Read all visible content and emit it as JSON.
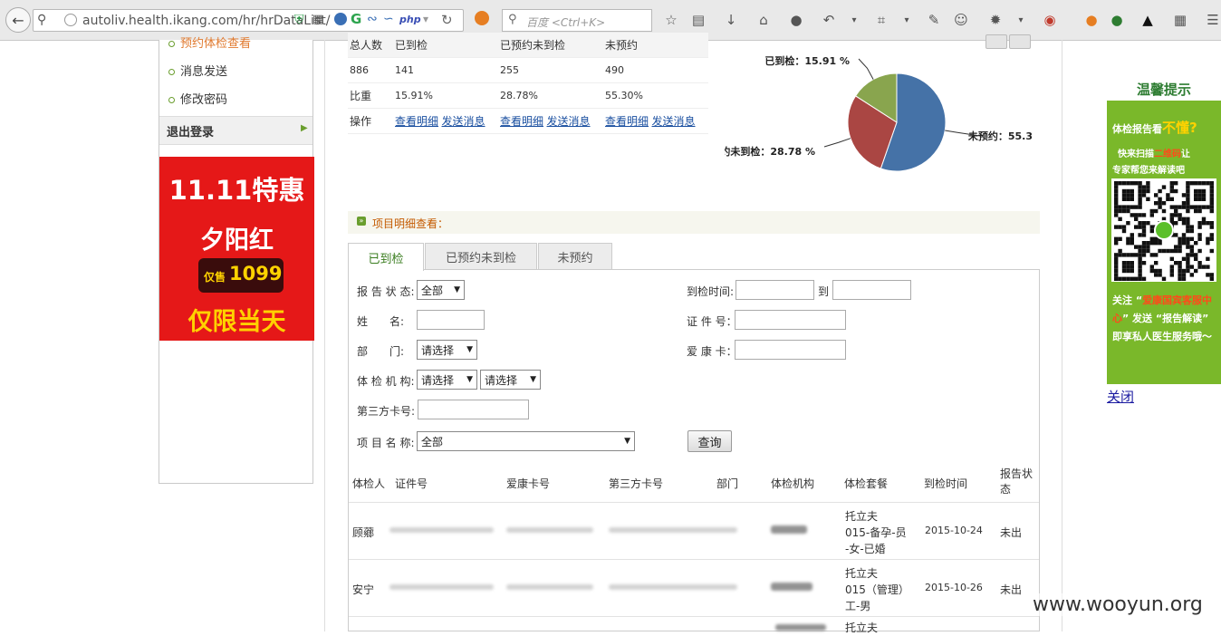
{
  "browser": {
    "url": "autoliv.health.ikang.com/hr/hrDataList/",
    "search_placeholder": "百度 <Ctrl+K>",
    "ext_php": "php"
  },
  "sidebar": {
    "items": [
      {
        "label": "预约体检查看"
      },
      {
        "label": "消息发送"
      },
      {
        "label": "修改密码"
      }
    ],
    "logout": "退出登录",
    "ad": {
      "line1": "11.11特惠",
      "line2": "夕阳红",
      "tag_prefix": "仅售",
      "tag_price": "1099",
      "line3": "仅限当天"
    }
  },
  "stats": {
    "headers": [
      "总人数",
      "已到检",
      "已预约未到检",
      "未预约"
    ],
    "counts": [
      "886",
      "141",
      "255",
      "490"
    ],
    "ratio_label": "比重",
    "ratios": [
      "15.91%",
      "28.78%",
      "55.30%"
    ],
    "ops_label": "操作",
    "view_label": "查看明细",
    "send_label": "发送消息"
  },
  "chart_data": {
    "type": "pie",
    "slices": [
      {
        "label": "未预约",
        "value": 55.3,
        "color": "#4572a7",
        "display": "未预约：55.3"
      },
      {
        "label": "已预约未到检",
        "value": 28.78,
        "color": "#aa4643",
        "display": "约未到检：28.78 %"
      },
      {
        "label": "已到检",
        "value": 15.91,
        "color": "#89a54e",
        "display": "已到检：15.91 %"
      }
    ]
  },
  "section": {
    "title": "项目明细查看："
  },
  "tabs": [
    "已到检",
    "已预约未到检",
    "未预约"
  ],
  "form": {
    "report_status_label": "报 告 状 态:",
    "report_status_value": "全部",
    "arrive_time_label": "到检时间:",
    "to_label": "到",
    "name_label": "姓　　名:",
    "idcard_label": "证 件 号：",
    "dept_label": "部　　门:",
    "dept_value": "请选择",
    "ikang_card_label": "爱 康 卡：",
    "org_label": "体 检 机 构:",
    "org_value1": "请选择",
    "org_value2": "请选择",
    "third_card_label": "第三方卡号:",
    "item_name_label": "项 目 名 称:",
    "item_name_value": "全部",
    "query_button": "查询"
  },
  "table": {
    "headers": [
      "体检人",
      "证件号",
      "爱康卡号",
      "第三方卡号",
      "部门",
      "体检机构",
      "体检套餐",
      "到检时间",
      "报告状态"
    ],
    "rows": [
      {
        "name": "顾薌",
        "package": [
          "托立夫",
          "015-备孕-员",
          "-女-已婚"
        ],
        "date": "2015-10-24",
        "status": "未出"
      },
      {
        "name": "安宁",
        "package": [
          "托立夫",
          "015（管理）",
          "工-男"
        ],
        "date": "2015-10-26",
        "status": "未出"
      },
      {
        "name": "",
        "package": [
          "托立夫"
        ],
        "date": "",
        "status": ""
      }
    ]
  },
  "tips": {
    "title": "温馨提示",
    "line1a": "体检报告看",
    "line1b": "不懂?",
    "line2a": "快来扫描",
    "line2b": "二维码",
    "line2c": "让",
    "line3": "专家帮您来解读吧",
    "line4a": "关注 “",
    "line4b": "爱康国宾客服中心",
    "line4c": "” 发送 “报告解读” 即享私人医生服务哦～",
    "close": "关闭"
  },
  "watermark": "www.wooyun.org"
}
